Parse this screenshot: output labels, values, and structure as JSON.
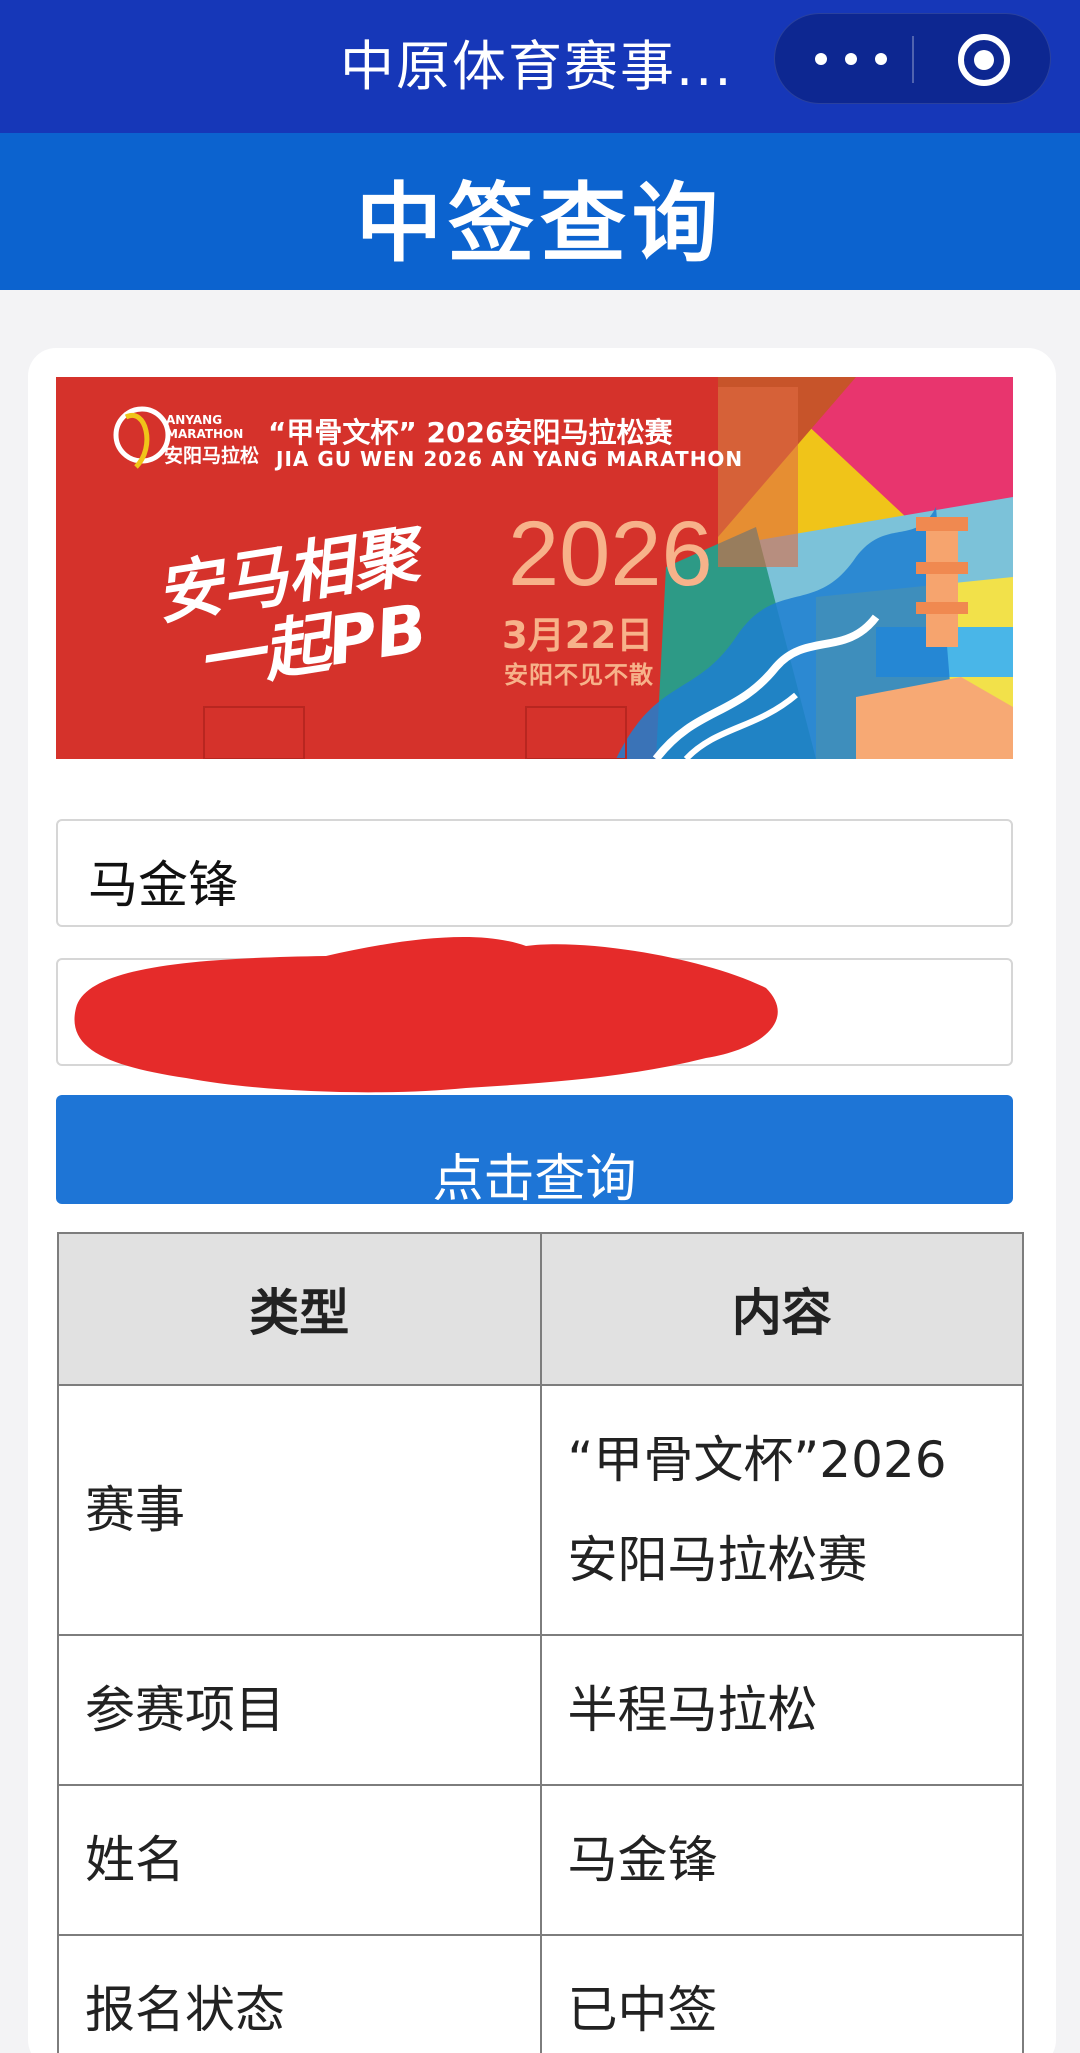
{
  "topbar": {
    "app_title": "中原体育赛事...",
    "more_icon": "more-dots-icon",
    "close_icon": "target-close-icon"
  },
  "header": {
    "title": "中签查询"
  },
  "banner": {
    "logo_en_line1": "ANYANG",
    "logo_en_line2": "MARATHON",
    "logo_cn": "安阳马拉松",
    "title_cn": "“甲骨文杯” 2026安阳马拉松赛",
    "title_en": "JIA GU WEN 2026 AN YANG MARATHON",
    "slogan_line1": "安马相聚",
    "slogan_line2": "一起PB",
    "year": "2026",
    "date": "3月22日",
    "tagline": "安阳不见不散"
  },
  "form": {
    "name_value": "马金锋",
    "query_button_label": "点击查询"
  },
  "table": {
    "headers": [
      "类型",
      "内容"
    ],
    "rows": [
      {
        "type": "赛事",
        "content": "“甲骨文杯”2026安阳马拉松赛"
      },
      {
        "type": "参赛项目",
        "content": "半程马拉松"
      },
      {
        "type": "姓名",
        "content": "马金锋"
      },
      {
        "type": "报名状态",
        "content": "已中签"
      }
    ]
  },
  "colors": {
    "topbar": "#1637b8",
    "header": "#0c63cf",
    "button": "#1e75d6",
    "status_selected": "#d8201e"
  }
}
